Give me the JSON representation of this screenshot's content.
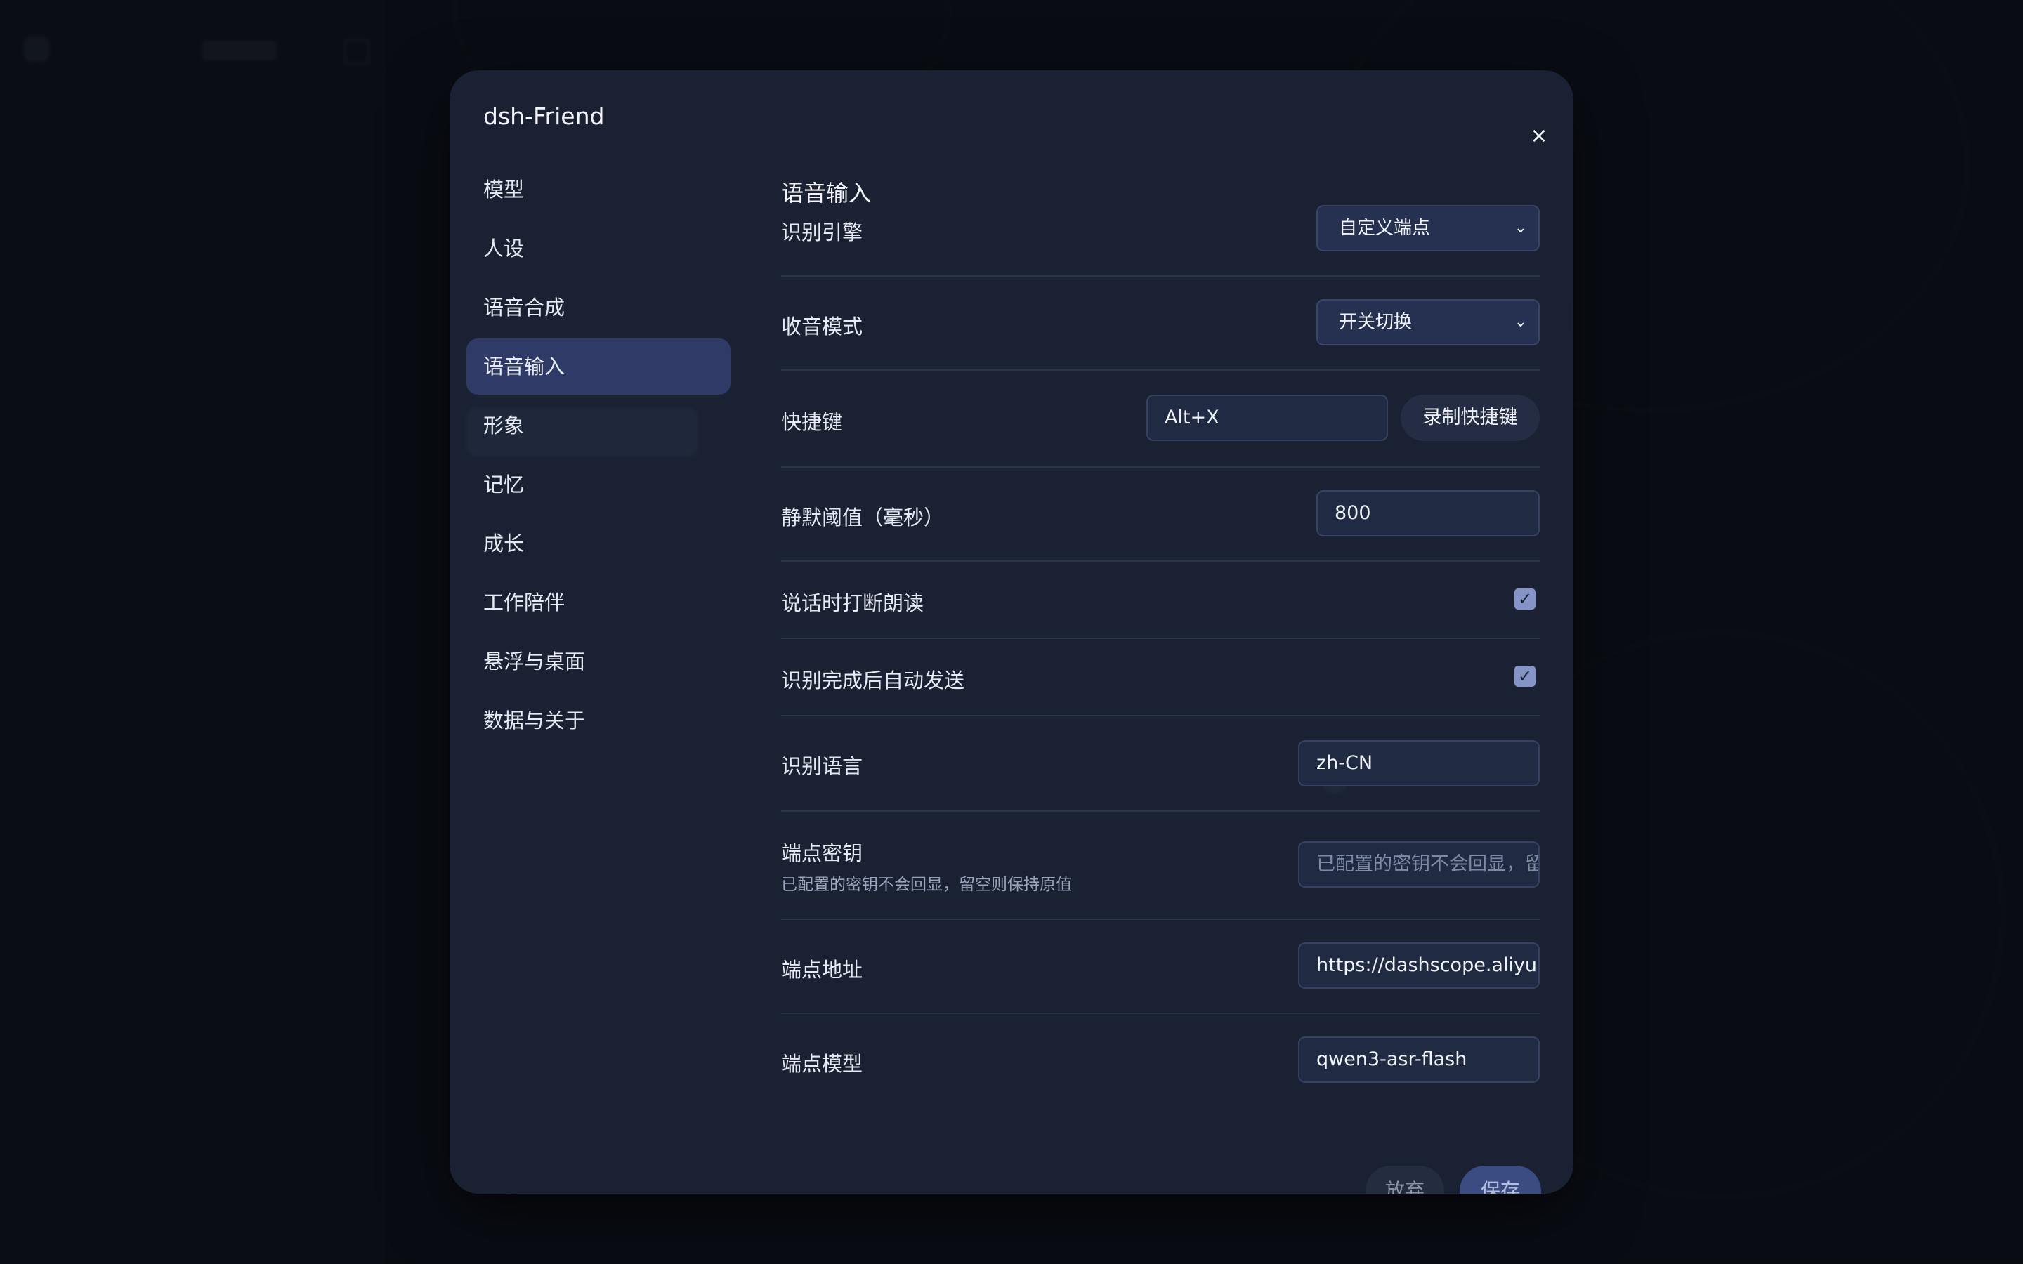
{
  "modal": {
    "title": "dsh-Friend",
    "close_label": "×"
  },
  "nav": {
    "items": [
      {
        "label": "模型"
      },
      {
        "label": "人设"
      },
      {
        "label": "语音合成"
      },
      {
        "label": "语音输入",
        "active": true
      },
      {
        "label": "形象"
      },
      {
        "label": "记忆"
      },
      {
        "label": "成长"
      },
      {
        "label": "工作陪伴"
      },
      {
        "label": "悬浮与桌面"
      },
      {
        "label": "数据与关于"
      }
    ]
  },
  "section": {
    "title": "语音输入",
    "engine": {
      "label": "识别引擎",
      "value": "自定义端点"
    },
    "capture_mode": {
      "label": "收音模式",
      "value": "开关切换"
    },
    "hotkey": {
      "label": "快捷键",
      "value": "Alt+X",
      "record_label": "录制快捷键"
    },
    "silence": {
      "label": "静默阈值（毫秒）",
      "value": "800"
    },
    "interrupt": {
      "label": "说话时打断朗读",
      "checked": true
    },
    "auto_send": {
      "label": "识别完成后自动发送",
      "checked": true
    },
    "language": {
      "label": "识别语言",
      "value": "zh-CN"
    },
    "endpoint_key": {
      "label": "端点密钥",
      "hint": "已配置的密钥不会回显，留空则保持原值",
      "placeholder": "已配置的密钥不会回显，留"
    },
    "endpoint_url": {
      "label": "端点地址",
      "value": "https://dashscope.aliyur"
    },
    "endpoint_model": {
      "label": "端点模型",
      "value": "qwen3-asr-flash"
    }
  },
  "footer": {
    "discard_label": "放弃",
    "save_label": "保存"
  },
  "icons": {
    "check": "✓",
    "chevron": "⌄"
  },
  "colors": {
    "accent": "#2f3b66",
    "checkbox": "#8594c7",
    "modal_bg": "#1a2133"
  }
}
